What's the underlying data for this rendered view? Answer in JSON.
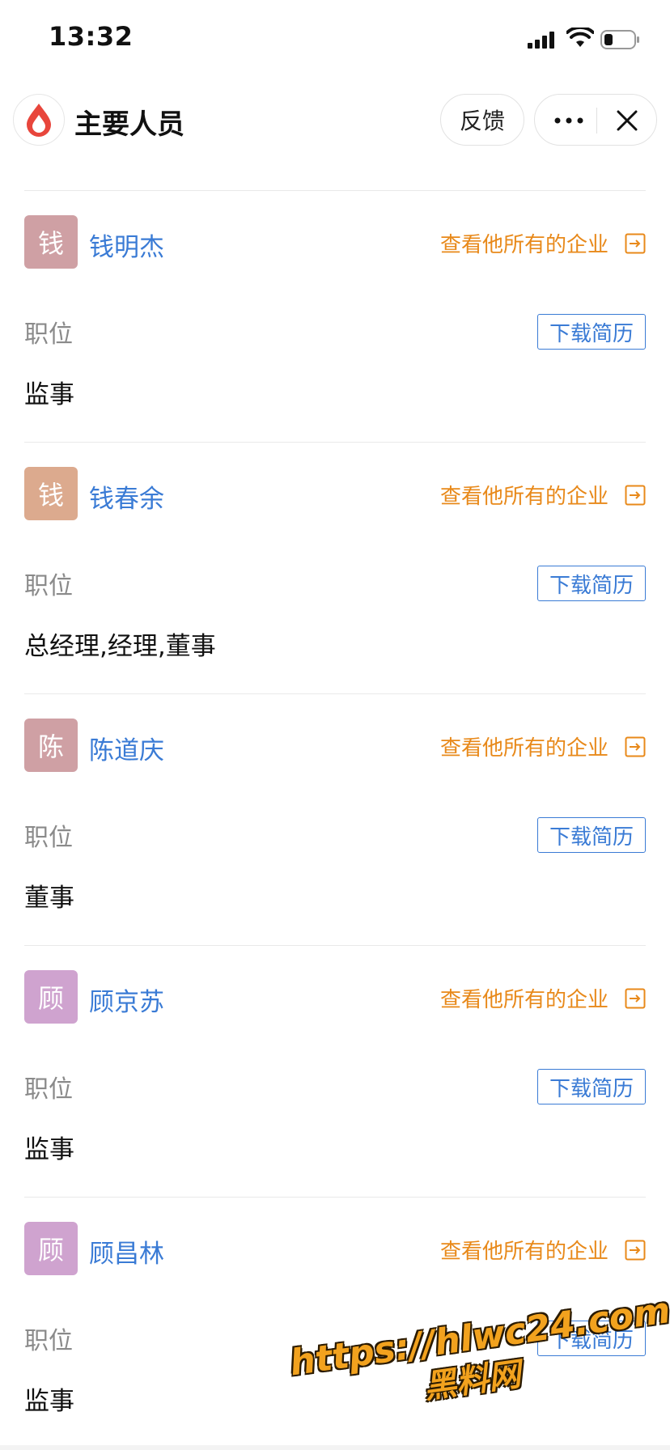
{
  "status_bar": {
    "time": "13:32",
    "icons": [
      "signal-icon",
      "wifi-icon",
      "battery-icon"
    ]
  },
  "navbar": {
    "title": "主要人员",
    "feedback_label": "反馈",
    "icons": [
      "app-logo-icon",
      "more-icon",
      "close-icon"
    ]
  },
  "labels": {
    "view_all": "查看他所有的企业",
    "position": "职位",
    "download_resume": "下载简历"
  },
  "people": [
    {
      "avatar_char": "钱",
      "name": "钱明杰",
      "position": "监事",
      "avatar_color": "#cfa0a4"
    },
    {
      "avatar_char": "钱",
      "name": "钱春余",
      "position": "总经理,经理,董事",
      "avatar_color": "#dcaa8e"
    },
    {
      "avatar_char": "陈",
      "name": "陈道庆",
      "position": "董事",
      "avatar_color": "#cfa0a4"
    },
    {
      "avatar_char": "顾",
      "name": "顾京苏",
      "position": "监事",
      "avatar_color": "#cfa3cf"
    },
    {
      "avatar_char": "顾",
      "name": "顾昌林",
      "position": "监事",
      "avatar_color": "#cfa3cf"
    }
  ],
  "watermark": {
    "url": "https://hlwc24.com",
    "name": "黑料网"
  },
  "colors": {
    "name_blue": "#3a7bd5",
    "link_orange": "#e8891a",
    "logo_red": "#e8463c"
  }
}
